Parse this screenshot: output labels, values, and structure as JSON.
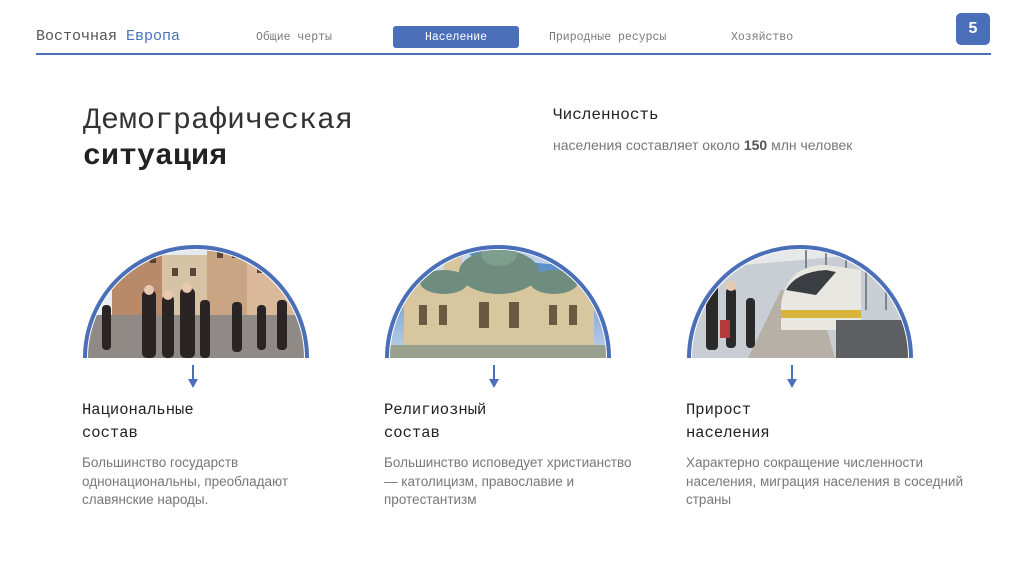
{
  "header": {
    "brand_main": "Восточная",
    "brand_accent": "Европа",
    "nav": [
      "Общие черты",
      "Население",
      "Природные ресурсы",
      "Хозяйство"
    ],
    "active_index": 1,
    "page_number": "5"
  },
  "colors": {
    "accent": "#4a6fb8",
    "muted": "#777777"
  },
  "main": {
    "title_line1": "Демографическая",
    "title_line2": "ситуация",
    "stat_title": "Численность",
    "stat_prefix": "населения составляет около",
    "stat_value": "150",
    "stat_suffix": "млн человек"
  },
  "cards": [
    {
      "title_line1": "Национальные",
      "title_line2": "состав",
      "description": "Большинство государств однонациональны, преобладают славянские народы.",
      "image": "city-square-photo"
    },
    {
      "title_line1": "Религиозный",
      "title_line2": "состав",
      "description": "Большинство исповедует христианство — католицизм, православие и протестантизм",
      "image": "cathedral-photo"
    },
    {
      "title_line1": "Прирост",
      "title_line2": "населения",
      "description": "Характерно сокращение численности населения, миграция населения в соседний страны",
      "image": "train-station-photo"
    }
  ]
}
